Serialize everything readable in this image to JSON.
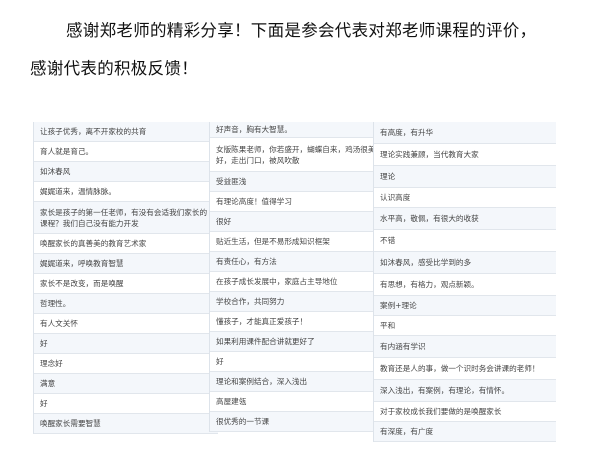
{
  "intro": {
    "line1": "感谢郑老师的精彩分享！下面是参会代表对郑老师课程的评价，",
    "line2": "感谢代表的积极反馈！"
  },
  "columns": [
    {
      "rows": [
        "让孩子优秀，离不开家校的共育",
        "育人就是育己。",
        "如沐春风",
        "娓娓道来，温情脉脉。",
        "家长是孩子的第一任老师，有没有会适我们家长的课程？我们自己没有能力开发",
        "唤醒家长的真善美的教育艺术家",
        "娓娓道来，呼唤教育智慧",
        "家长不是改变，而是唤醒",
        "哲理性。",
        "有人文关怀",
        "好",
        "理念好",
        "满意",
        "好",
        "唤醒家长需要智慧"
      ]
    },
    {
      "rows": [
        "好声音，胸有大智慧。",
        "女版陈果老师，你若盛开，蝴蝶自来，鸡汤很美好，走出门口，被风吹散",
        "受益匪浅",
        "有理论高度！值得学习",
        "很好",
        "贴近生活，但是不易形成知识框架",
        "有责任心，有方法",
        "在孩子成长发展中，家庭占主导地位",
        "学校合作，共同努力",
        "懂孩子，才能真正爱孩子！",
        "如果利用课件配合讲就更好了",
        "好",
        "理论和案例结合，深入浅出",
        "高屋建瓴",
        "很优秀的一节课"
      ]
    },
    {
      "rows": [
        "有高度，有升华",
        "理论实践兼顾，当代教育大家",
        "理论",
        "认识高度",
        "水平高，敬佩，有很大的收获",
        "不错",
        "如沐春风，感受比学到的多",
        "有思想，有格力，观点新颖。",
        "案例+理论",
        "平和",
        "有内涵有学识",
        "教育还是人的事，做一个识时务会讲课的老师！",
        "深入浅出，有案例，有理论，有情怀。",
        "对于家校成长我们要做的是唤醒家长",
        "有深度，有广度"
      ]
    }
  ]
}
